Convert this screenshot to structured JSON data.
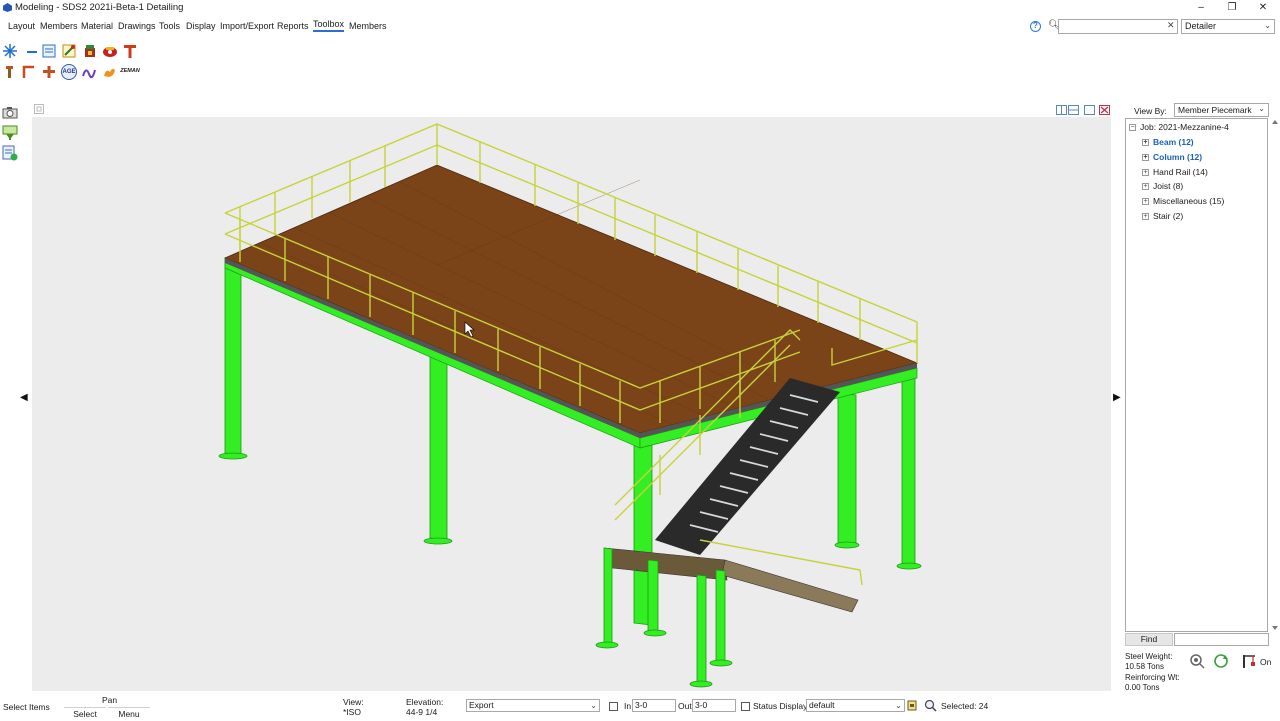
{
  "window": {
    "title": "Modeling - SDS2 2021i-Beta-1 Detailing",
    "minimize": "–",
    "restore": "❐",
    "close": "✕"
  },
  "menu": {
    "items": [
      "Layout",
      "Members",
      "Material",
      "Drawings",
      "Tools",
      "Display",
      "Import/Export",
      "Reports",
      "Toolbox",
      "Members"
    ],
    "active": "Toolbox"
  },
  "header": {
    "help_icon": "?",
    "search_value": "",
    "search_clear": "✕",
    "role_value": "Detailer"
  },
  "toolbox": {
    "row1_icons": [
      "sparkle-icon",
      "line-icon",
      "sheet-icon",
      "pencil-sheet-icon",
      "paint-bucket-icon",
      "gear-red-icon",
      "t-beam-icon"
    ],
    "row2_icons": [
      "pin-icon",
      "angle-icon",
      "cross-icon",
      "age-icon",
      "script-icon",
      "flame-icon",
      "zeman-icon"
    ],
    "age_label": "AGE",
    "zeman_label": "ZEMAN"
  },
  "right_panel": {
    "view_by_label": "View By:",
    "view_by_value": "Member Piecemark",
    "tree_root": "Job: 2021-Mezzanine-4",
    "tree_items": [
      {
        "label": "Beam (12)",
        "bold": true
      },
      {
        "label": "Column (12)",
        "bold": true
      },
      {
        "label": "Hand Rail (14)",
        "bold": false
      },
      {
        "label": "Joist (8)",
        "bold": false
      },
      {
        "label": "Miscellaneous (15)",
        "bold": false
      },
      {
        "label": "Stair (2)",
        "bold": false
      }
    ],
    "find_label": "Find",
    "steel_weight_label": "Steel Weight:",
    "steel_weight_value": "10.58 Tons",
    "reinforcing_label": "Reinforcing Wt:",
    "reinforcing_value": "0.00 Tons",
    "on_label": "On"
  },
  "statusbar": {
    "select_items": "Select Items",
    "pan": "Pan",
    "select": "Select",
    "menu": "Menu",
    "view_label": "View:",
    "view_value": "*ISO",
    "elevation_label": "Elevation:",
    "elevation_value": "44-9 1/4",
    "export_value": "Export",
    "in_label": "In",
    "in_value": "3-0",
    "out_label": "Out",
    "out_value": "3-0",
    "status_display_label": "Status Display",
    "display_value": "default",
    "selected_label": "Selected: 24"
  },
  "colors": {
    "steel_green": "#33ee22",
    "rail_yellow": "#c8d23a",
    "deck_brown": "#7a4318",
    "stair_dark": "#2a2a2a",
    "accent_blue": "#1a62b8"
  }
}
